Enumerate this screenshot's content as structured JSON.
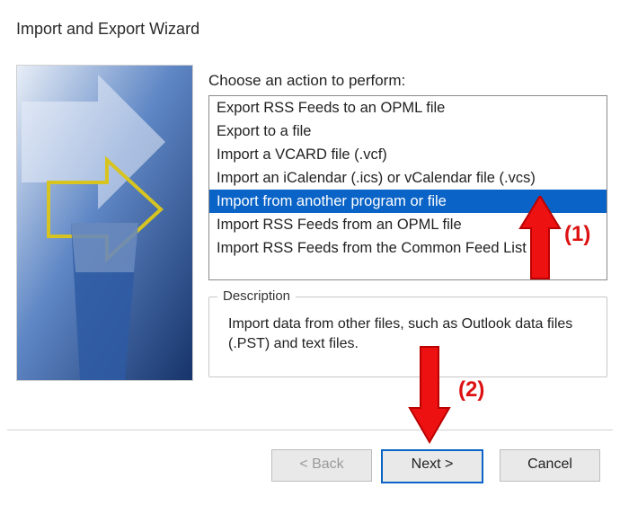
{
  "window": {
    "title": "Import and Export Wizard"
  },
  "prompt": "Choose an action to perform:",
  "actions": {
    "selected_index": 4,
    "items": [
      "Export RSS Feeds to an OPML file",
      "Export to a file",
      "Import a VCARD file (.vcf)",
      "Import an iCalendar (.ics) or vCalendar file (.vcs)",
      "Import from another program or file",
      "Import RSS Feeds from an OPML file",
      "Import RSS Feeds from the Common Feed List"
    ]
  },
  "description": {
    "label": "Description",
    "text": "Import data from other files, such as Outlook data files (.PST) and text files."
  },
  "buttons": {
    "back": "< Back",
    "next": "Next >",
    "cancel": "Cancel"
  },
  "annotations": {
    "one": "(1)",
    "two": "(2)"
  }
}
